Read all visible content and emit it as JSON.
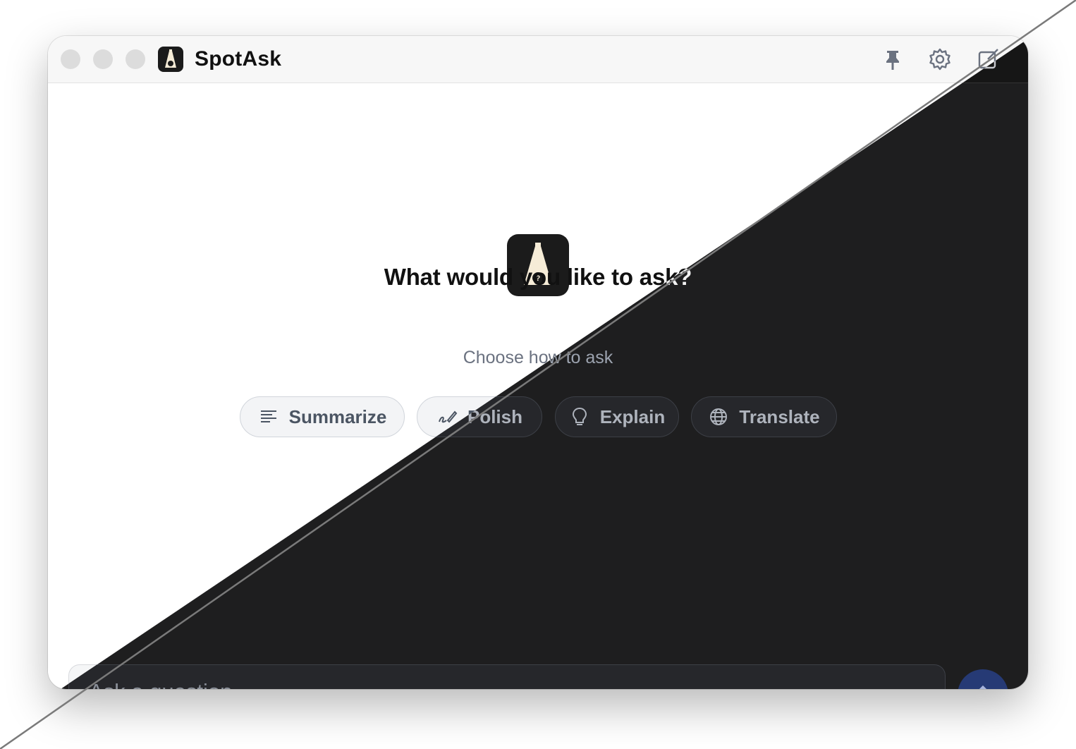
{
  "app": {
    "title": "SpotAsk"
  },
  "toolbar": {
    "icons": [
      "pin-icon",
      "gear-icon",
      "compose-icon"
    ]
  },
  "hero": {
    "title": "What would you like to ask?",
    "subtitle": "Choose how to ask"
  },
  "actions": [
    {
      "label": "Summarize",
      "icon": "lines-icon"
    },
    {
      "label": "Polish",
      "icon": "pen-icon"
    },
    {
      "label": "Explain",
      "icon": "lightbulb-icon"
    },
    {
      "label": "Translate",
      "icon": "globe-icon"
    }
  ],
  "composer": {
    "placeholder": "Ask a question...",
    "send_icon": "arrow-up-icon"
  },
  "colors": {
    "accent": "#31468a",
    "dark_bg": "#1e1e1f",
    "light_bg": "#ffffff"
  }
}
